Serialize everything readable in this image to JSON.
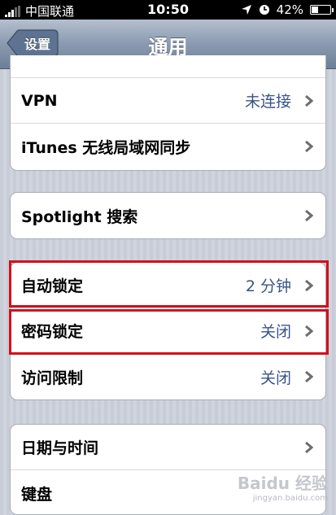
{
  "status_bar": {
    "carrier": "中国联通",
    "time": "10:50",
    "battery_percent": "42%",
    "battery_level": 0.42,
    "icons": [
      "signal-icon",
      "location-arrow-icon",
      "alarm-clock-icon",
      "battery-icon"
    ]
  },
  "nav": {
    "back_label": "设置",
    "title": "通用"
  },
  "groups": [
    {
      "rows": [
        {
          "label": "VPN",
          "value": "未连接"
        },
        {
          "label": "iTunes 无线局域网同步",
          "value": ""
        }
      ]
    },
    {
      "rows": [
        {
          "label": "Spotlight 搜索",
          "value": ""
        }
      ]
    },
    {
      "rows": [
        {
          "label": "自动锁定",
          "value": "2 分钟"
        },
        {
          "label": "密码锁定",
          "value": "关闭"
        },
        {
          "label": "访问限制",
          "value": "关闭"
        }
      ]
    },
    {
      "rows": [
        {
          "label": "日期与时间",
          "value": ""
        },
        {
          "label": "键盘",
          "value": ""
        }
      ]
    }
  ],
  "highlight_color": "#d40f1c",
  "watermark": {
    "brand": "Baidu 经验",
    "url": "jingyan.baidu.com"
  }
}
